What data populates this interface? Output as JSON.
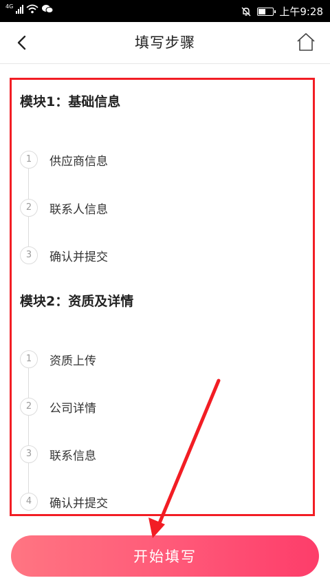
{
  "status_bar": {
    "network": "4G",
    "time": "上午9:28",
    "battery_level": 0.55
  },
  "header": {
    "title": "填写步骤",
    "back_icon": "back-chevron-icon",
    "home_icon": "home-icon"
  },
  "modules": [
    {
      "title": "模块1：基础信息",
      "steps": [
        {
          "num": "1",
          "label": "供应商信息"
        },
        {
          "num": "2",
          "label": "联系人信息"
        },
        {
          "num": "3",
          "label": "确认并提交"
        }
      ]
    },
    {
      "title": "模块2：资质及详情",
      "steps": [
        {
          "num": "1",
          "label": "资质上传"
        },
        {
          "num": "2",
          "label": "公司详情"
        },
        {
          "num": "3",
          "label": "联系信息"
        },
        {
          "num": "4",
          "label": "确认并提交"
        }
      ]
    }
  ],
  "start_button": {
    "label": "开始填写"
  },
  "colors": {
    "highlight_box": "#f21d24",
    "button_gradient_start": "#ff7582",
    "button_gradient_end": "#fd3d6a",
    "arrow": "#f21d24"
  }
}
